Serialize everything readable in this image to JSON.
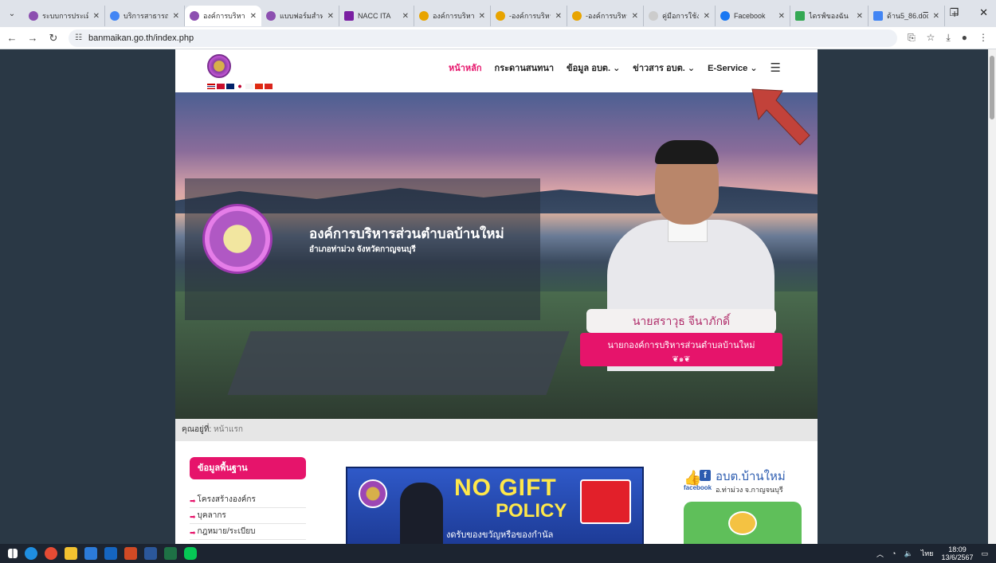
{
  "browser": {
    "tabs": [
      {
        "title": "ระบบการประเมิ",
        "color": "#8c4fb0"
      },
      {
        "title": "บริการสาธารณ",
        "color": "#4285f4"
      },
      {
        "title": "องค์การบริหาร",
        "color": "#8c4fb0",
        "active": true
      },
      {
        "title": "แบบฟอร์มสำหรั",
        "color": "#8c4fb0"
      },
      {
        "title": "NACC ITA",
        "color": "#7a1fa2"
      },
      {
        "title": "องค์การบริหาร",
        "color": "#e8a400"
      },
      {
        "title": "-องค์การบริหา",
        "color": "#e8a400"
      },
      {
        "title": "-องค์การบริหา",
        "color": "#e8a400"
      },
      {
        "title": "คู่มือการใช้งาน",
        "color": "#cccccc"
      },
      {
        "title": "Facebook",
        "color": "#1877f2"
      },
      {
        "title": "ไดรฟ์ของฉัน",
        "color": "#34a853"
      },
      {
        "title": "ด้าน5_86.doc",
        "color": "#4285f4"
      }
    ],
    "new_tab": "+",
    "url": "banmaikan.go.th/index.php"
  },
  "site": {
    "nav": {
      "home": "หน้าหลัก",
      "forum": "กระดานสนทนา",
      "info": "ข้อมูล อบต.",
      "news": "ข่าวสาร อบต.",
      "eservice": "E-Service"
    },
    "hero": {
      "org_name": "องค์การบริหารส่วนตำบลบ้านใหม่",
      "org_location": "อำเภอท่าม่วง จังหวัดกาญจนบุรี",
      "mayor_name": "นายสราวุธ จีนาภักดิ์",
      "mayor_title": "นายกองค์การบริหารส่วนตำบลบ้านใหม่",
      "ornament": "❦๑❦"
    },
    "breadcrumb": {
      "label": "คุณอยู่ที่:",
      "current": "หน้าแรก"
    },
    "sidebar": {
      "header": "ข้อมูลพื้นฐาน",
      "items": [
        "โครงสร้างองค์กร",
        "บุคลากร",
        "กฎหมาย/ระเบียบ"
      ]
    },
    "banner": {
      "line1": "NO GIFT",
      "line2": "POLICY",
      "sub": "งดรับของขวัญหรือของกำนัล"
    },
    "facebook": {
      "name": "อบต.บ้านใหม่",
      "label": "facebook",
      "location": "อ.ท่าม่วง จ.กาญจนบุรี"
    }
  },
  "taskbar": {
    "lang": "ไทย",
    "time": "18:09",
    "date": "13/6/2567"
  },
  "colors": {
    "accent": "#e6146b",
    "arrow": "#c2423a"
  }
}
